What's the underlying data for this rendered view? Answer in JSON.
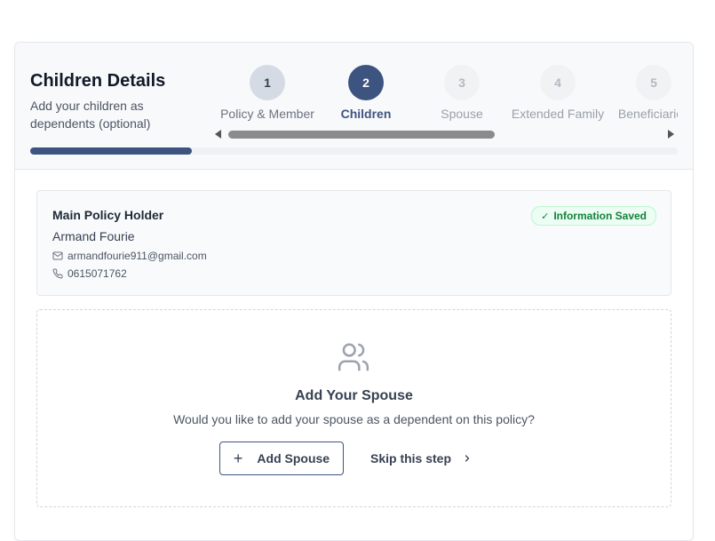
{
  "header": {
    "title": "Children Details",
    "subtitle": "Add your children as dependents (optional)",
    "progress_fraction": 0.25
  },
  "steps": [
    {
      "number": "1",
      "label": "Policy & Member",
      "state": "done"
    },
    {
      "number": "2",
      "label": "Children",
      "state": "active"
    },
    {
      "number": "3",
      "label": "Spouse",
      "state": "pending"
    },
    {
      "number": "4",
      "label": "Extended Family",
      "state": "pending"
    },
    {
      "number": "5",
      "label": "Beneficiaries",
      "state": "pending"
    }
  ],
  "holder": {
    "title": "Main Policy Holder",
    "name": "Armand Fourie",
    "email": "armandfourie911@gmail.com",
    "phone": "0615071762",
    "badge": "Information Saved",
    "badge_icon": "check-icon"
  },
  "spouse": {
    "icon": "users-icon",
    "title": "Add Your Spouse",
    "description": "Would you like to add your spouse as a dependent on this policy?",
    "add_label": "Add Spouse",
    "skip_label": "Skip this step"
  },
  "colors": {
    "primary": "#3e5480",
    "success": "#15803d",
    "success_bg": "#ecfdf3"
  }
}
